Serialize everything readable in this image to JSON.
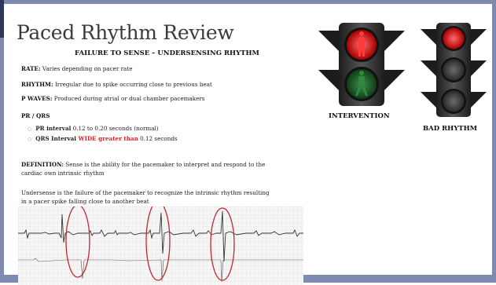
{
  "slide": {
    "title": "Paced Rhythm Review",
    "subtitle": "FAILURE TO SENSE – UNDERSENSING RHYTHM",
    "rate_label": "RATE:",
    "rate_text": " Varies depending on pacer rate",
    "rhythm_label": "RHYTHM:",
    "rhythm_text": " Irregular due to spike occurring close to previous beat",
    "pwaves_label": "P WAVES:",
    "pwaves_text": " Produced during atrial or dual chamber pacemakers",
    "prqrs_label": "PR / QRS",
    "pr_label": "PR interval",
    "pr_text": " 0.12 to 0.20 seconds (normal)",
    "qrs_label": "QRS Interval ",
    "qrs_highlight": "WIDE greater than",
    "qrs_text": " 0.12 seconds",
    "definition_label": "DEFINITION:",
    "definition_text1": " Sense is the ability for the pacemaker to interpret and respond to the",
    "definition_text2": "cardiac own intrinsic rhythm",
    "undersense_text1": "Undersense is the failure of the pacemaker to recognize the intrinsic rhythm resulting",
    "undersense_text2": "in a pacer spike falling close to another beat",
    "intervention_caption": "INTERVENTION",
    "bad_rhythm_caption": "BAD RHYTHM"
  },
  "colors": {
    "accent_red": "#e0202a",
    "frame": "#7e8ab0",
    "circle": "#c0272d"
  },
  "icons": {
    "intervention_light": "pedestrian-traffic-light-icon",
    "bad_rhythm_light": "red-traffic-light-icon"
  }
}
